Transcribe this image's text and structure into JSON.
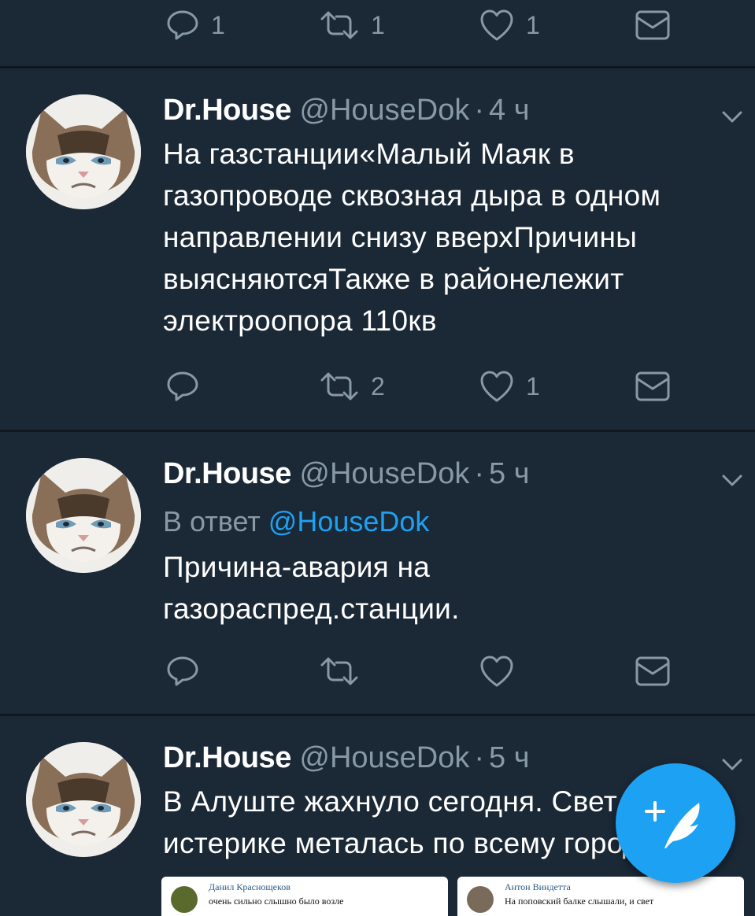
{
  "top_actions": {
    "reply_count": "1",
    "retweet_count": "1",
    "like_count": "1"
  },
  "tweets": [
    {
      "name": "Dr.House",
      "handle": "@HouseDok",
      "separator": "·",
      "time": "4 ч",
      "lines": [
        "На газстанции«Малый Маяк в",
        "газопроводе сквозная дыра в одном",
        "направлении снизу вверхПричины",
        "выясняютсяТакже в районележит",
        "электроопора 110кв"
      ],
      "retweet_count": "2",
      "like_count": "1"
    },
    {
      "name": "Dr.House",
      "handle": "@HouseDok",
      "separator": "·",
      "time": "5 ч",
      "reply_prefix": "В ответ",
      "reply_to": "@HouseDok",
      "lines": [
        "Причина-авария на",
        "газораспред.станции."
      ]
    },
    {
      "name": "Dr.House",
      "handle": "@HouseDok",
      "separator": "·",
      "time": "5 ч",
      "lines": [
        "В  Алуште жахнуло сегодня. Свет в",
        "истерике металась по всему городу"
      ],
      "attachments": [
        {
          "author": "Данил Краснощеков",
          "text": "очень сильно слышно было возле"
        },
        {
          "author": "Антон Виндетта",
          "text": "На поповский балке слышали, и свет"
        }
      ]
    }
  ],
  "icons": {
    "reply": "reply-icon",
    "retweet": "retweet-icon",
    "like": "heart-icon",
    "dm": "envelope-icon",
    "menu": "chevron-down-icon",
    "compose": "compose-tweet-icon"
  },
  "colors": {
    "background": "#141d26",
    "card": "#1b2836",
    "secondary_text": "#8899a6",
    "accent": "#1da1f2"
  }
}
